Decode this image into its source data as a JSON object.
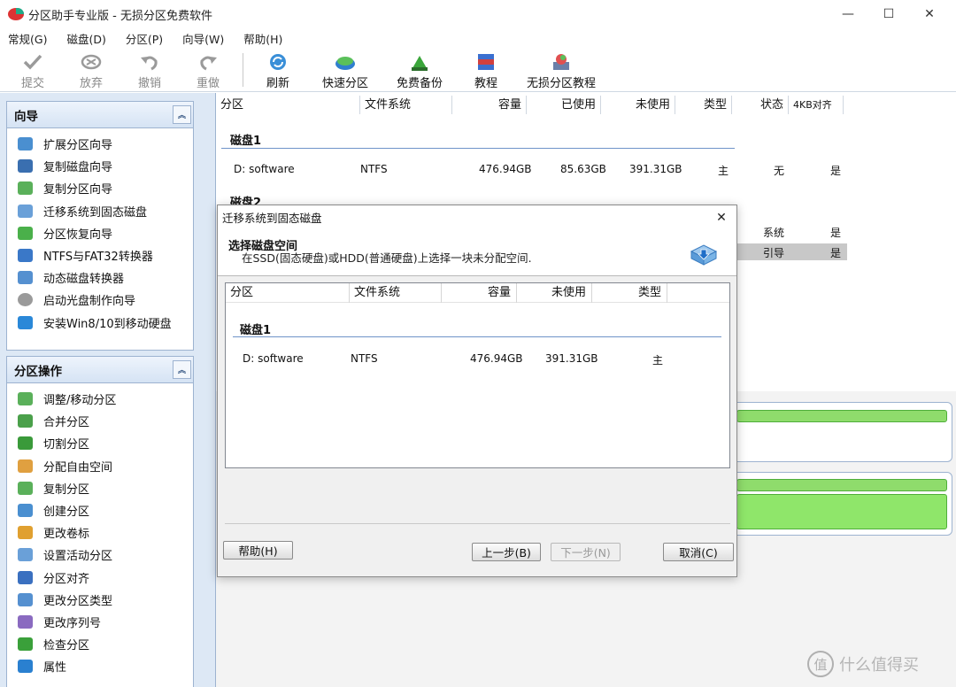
{
  "window": {
    "title": "分区助手专业版 - 无损分区免费软件",
    "minimize": "—",
    "maximize": "☐",
    "close": "✕"
  },
  "menu": [
    "常规(G)",
    "磁盘(D)",
    "分区(P)",
    "向导(W)",
    "帮助(H)"
  ],
  "toolbar": {
    "commit": "提交",
    "discard": "放弃",
    "undo": "撤销",
    "redo": "重做",
    "refresh": "刷新",
    "quick_partition": "快速分区",
    "free_backup": "免费备份",
    "tutorial": "教程",
    "lossless_tutorial": "无损分区教程"
  },
  "wizard_group": {
    "title": "向导",
    "items": [
      "扩展分区向导",
      "复制磁盘向导",
      "复制分区向导",
      "迁移系统到固态磁盘",
      "分区恢复向导",
      "NTFS与FAT32转换器",
      "动态磁盘转换器",
      "启动光盘制作向导",
      "安装Win8/10到移动硬盘"
    ]
  },
  "ops_group": {
    "title": "分区操作",
    "items": [
      "调整/移动分区",
      "合并分区",
      "切割分区",
      "分配自由空间",
      "复制分区",
      "创建分区",
      "更改卷标",
      "设置活动分区",
      "分区对齐",
      "更改分区类型",
      "更改序列号",
      "检查分区",
      "属性"
    ]
  },
  "table": {
    "headers": [
      "分区",
      "文件系统",
      "容量",
      "已使用",
      "未使用",
      "类型",
      "状态",
      "4KB对齐"
    ],
    "disk1": {
      "label": "磁盘1",
      "row": {
        "name": "D: software",
        "fs": "NTFS",
        "capacity": "476.94GB",
        "used": "85.63GB",
        "free": "391.31GB",
        "type": "主",
        "status": "无",
        "aligned": "是"
      }
    },
    "disk2": {
      "label": "磁盘2",
      "row1": {
        "status": "系统",
        "aligned": "是"
      },
      "row2": {
        "status": "引导",
        "aligned": "是"
      }
    }
  },
  "dialog": {
    "title": "迁移系统到固态磁盘",
    "heading": "选择磁盘空间",
    "subheading": "在SSD(固态硬盘)或HDD(普通硬盘)上选择一块未分配空间.",
    "headers": [
      "分区",
      "文件系统",
      "容量",
      "未使用",
      "类型"
    ],
    "disk_label": "磁盘1",
    "row": {
      "name": "D:  software",
      "fs": "NTFS",
      "capacity": "476.94GB",
      "free": "391.31GB",
      "type": "主"
    },
    "help": "帮助(H)",
    "back": "上一步(B)",
    "next": "下一步(N)",
    "cancel": "取消(C)"
  },
  "watermark": {
    "logo": "值",
    "text": "什么值得买"
  }
}
